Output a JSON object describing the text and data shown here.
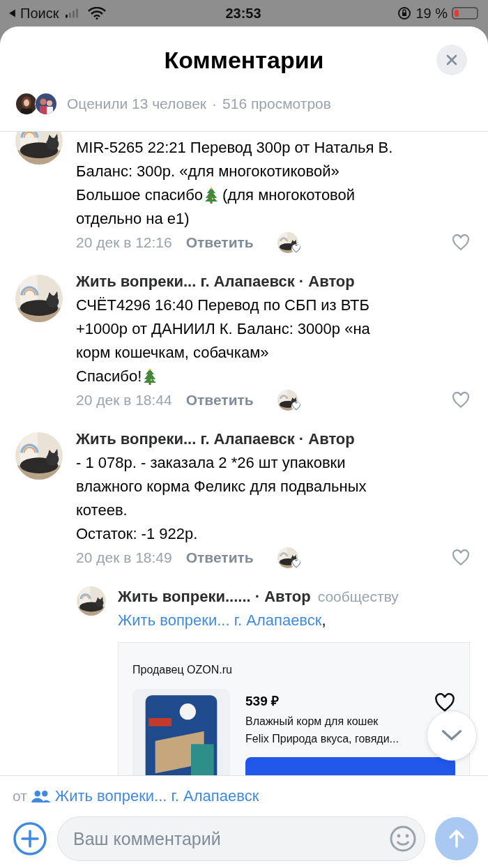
{
  "status_bar": {
    "back_label": "Поиск",
    "time": "23:53",
    "battery": "19 %"
  },
  "header": {
    "title": "Комментарии"
  },
  "summary": {
    "likes": "Оценили 13 человек",
    "separator": "·",
    "views": "516 просмотров"
  },
  "comments": [
    {
      "lines": [
        [
          {
            "text": "MIR-5265 22:21 Перевод 300р от Наталья В."
          }
        ],
        [
          {
            "text": "Баланс: 300р. «для многокотиковой»"
          }
        ],
        [
          {
            "text": "Большое спасибо"
          },
          {
            "kind": "tree"
          },
          {
            "text": " (для многокотовой"
          }
        ],
        [
          {
            "text": "отдельно на е1)"
          }
        ]
      ],
      "date": "20 дек в 12:16",
      "reply": "Ответить"
    },
    {
      "author": "Жить вопреки... г. Алапаевск · Автор",
      "lines": [
        [
          {
            "text": "СЧЁТ4296 16:40 Перевод по СБП из ВТБ"
          }
        ],
        [
          {
            "text": "+1000р от ДАНИИЛ К. Баланс: 3000р «на"
          }
        ],
        [
          {
            "text": "корм кошечкам, собачкам»"
          }
        ],
        [
          {
            "text": "Спасибо!"
          },
          {
            "kind": "tree"
          }
        ]
      ],
      "date": "20 дек в 18:44",
      "reply": "Ответить"
    },
    {
      "author": "Жить вопреки... г. Алапаевск · Автор",
      "lines": [
        [
          {
            "text": "- 1 078р. - заказала 2 *26 шт упаковки"
          }
        ],
        [
          {
            "text": "влажного корма Феликс для подвальных"
          }
        ],
        [
          {
            "text": "котеев."
          }
        ],
        [
          {
            "text": "Остаток: -1 922р."
          }
        ]
      ],
      "date": "20 дек в 18:49",
      "reply": "Ответить"
    }
  ],
  "reply_comment": {
    "author": "Жить вопреки...... · Автор",
    "to_label": "сообществу",
    "to_link": "Жить вопреки... г. Алапаевск",
    "punct": ",",
    "product_card": {
      "seller": "Продавец OZON.ru",
      "price": "539 ₽",
      "title_line_1": "Влажный корм для кошек",
      "title_line_2": "Felix Природа вкуса, говяди..."
    }
  },
  "composer": {
    "from_label": "от",
    "from_link": "Жить вопреки... г. Алапаевск",
    "placeholder": "Ваш комментарий"
  }
}
